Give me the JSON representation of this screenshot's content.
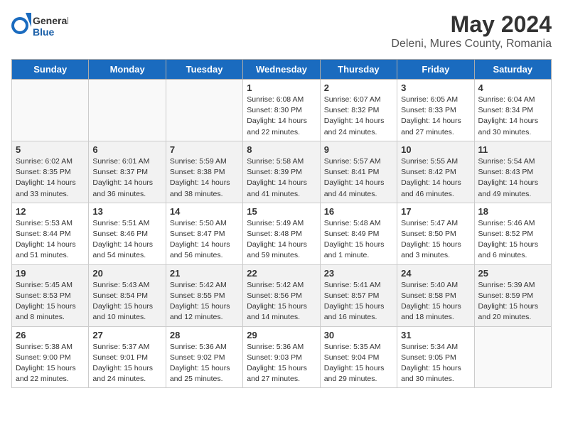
{
  "logo": {
    "text_general": "General",
    "text_blue": "Blue"
  },
  "title": "May 2024",
  "subtitle": "Deleni, Mures County, Romania",
  "days_of_week": [
    "Sunday",
    "Monday",
    "Tuesday",
    "Wednesday",
    "Thursday",
    "Friday",
    "Saturday"
  ],
  "weeks": [
    [
      {
        "day": "",
        "info": ""
      },
      {
        "day": "",
        "info": ""
      },
      {
        "day": "",
        "info": ""
      },
      {
        "day": "1",
        "info": "Sunrise: 6:08 AM\nSunset: 8:30 PM\nDaylight: 14 hours\nand 22 minutes."
      },
      {
        "day": "2",
        "info": "Sunrise: 6:07 AM\nSunset: 8:32 PM\nDaylight: 14 hours\nand 24 minutes."
      },
      {
        "day": "3",
        "info": "Sunrise: 6:05 AM\nSunset: 8:33 PM\nDaylight: 14 hours\nand 27 minutes."
      },
      {
        "day": "4",
        "info": "Sunrise: 6:04 AM\nSunset: 8:34 PM\nDaylight: 14 hours\nand 30 minutes."
      }
    ],
    [
      {
        "day": "5",
        "info": "Sunrise: 6:02 AM\nSunset: 8:35 PM\nDaylight: 14 hours\nand 33 minutes."
      },
      {
        "day": "6",
        "info": "Sunrise: 6:01 AM\nSunset: 8:37 PM\nDaylight: 14 hours\nand 36 minutes."
      },
      {
        "day": "7",
        "info": "Sunrise: 5:59 AM\nSunset: 8:38 PM\nDaylight: 14 hours\nand 38 minutes."
      },
      {
        "day": "8",
        "info": "Sunrise: 5:58 AM\nSunset: 8:39 PM\nDaylight: 14 hours\nand 41 minutes."
      },
      {
        "day": "9",
        "info": "Sunrise: 5:57 AM\nSunset: 8:41 PM\nDaylight: 14 hours\nand 44 minutes."
      },
      {
        "day": "10",
        "info": "Sunrise: 5:55 AM\nSunset: 8:42 PM\nDaylight: 14 hours\nand 46 minutes."
      },
      {
        "day": "11",
        "info": "Sunrise: 5:54 AM\nSunset: 8:43 PM\nDaylight: 14 hours\nand 49 minutes."
      }
    ],
    [
      {
        "day": "12",
        "info": "Sunrise: 5:53 AM\nSunset: 8:44 PM\nDaylight: 14 hours\nand 51 minutes."
      },
      {
        "day": "13",
        "info": "Sunrise: 5:51 AM\nSunset: 8:46 PM\nDaylight: 14 hours\nand 54 minutes."
      },
      {
        "day": "14",
        "info": "Sunrise: 5:50 AM\nSunset: 8:47 PM\nDaylight: 14 hours\nand 56 minutes."
      },
      {
        "day": "15",
        "info": "Sunrise: 5:49 AM\nSunset: 8:48 PM\nDaylight: 14 hours\nand 59 minutes."
      },
      {
        "day": "16",
        "info": "Sunrise: 5:48 AM\nSunset: 8:49 PM\nDaylight: 15 hours\nand 1 minute."
      },
      {
        "day": "17",
        "info": "Sunrise: 5:47 AM\nSunset: 8:50 PM\nDaylight: 15 hours\nand 3 minutes."
      },
      {
        "day": "18",
        "info": "Sunrise: 5:46 AM\nSunset: 8:52 PM\nDaylight: 15 hours\nand 6 minutes."
      }
    ],
    [
      {
        "day": "19",
        "info": "Sunrise: 5:45 AM\nSunset: 8:53 PM\nDaylight: 15 hours\nand 8 minutes."
      },
      {
        "day": "20",
        "info": "Sunrise: 5:43 AM\nSunset: 8:54 PM\nDaylight: 15 hours\nand 10 minutes."
      },
      {
        "day": "21",
        "info": "Sunrise: 5:42 AM\nSunset: 8:55 PM\nDaylight: 15 hours\nand 12 minutes."
      },
      {
        "day": "22",
        "info": "Sunrise: 5:42 AM\nSunset: 8:56 PM\nDaylight: 15 hours\nand 14 minutes."
      },
      {
        "day": "23",
        "info": "Sunrise: 5:41 AM\nSunset: 8:57 PM\nDaylight: 15 hours\nand 16 minutes."
      },
      {
        "day": "24",
        "info": "Sunrise: 5:40 AM\nSunset: 8:58 PM\nDaylight: 15 hours\nand 18 minutes."
      },
      {
        "day": "25",
        "info": "Sunrise: 5:39 AM\nSunset: 8:59 PM\nDaylight: 15 hours\nand 20 minutes."
      }
    ],
    [
      {
        "day": "26",
        "info": "Sunrise: 5:38 AM\nSunset: 9:00 PM\nDaylight: 15 hours\nand 22 minutes."
      },
      {
        "day": "27",
        "info": "Sunrise: 5:37 AM\nSunset: 9:01 PM\nDaylight: 15 hours\nand 24 minutes."
      },
      {
        "day": "28",
        "info": "Sunrise: 5:36 AM\nSunset: 9:02 PM\nDaylight: 15 hours\nand 25 minutes."
      },
      {
        "day": "29",
        "info": "Sunrise: 5:36 AM\nSunset: 9:03 PM\nDaylight: 15 hours\nand 27 minutes."
      },
      {
        "day": "30",
        "info": "Sunrise: 5:35 AM\nSunset: 9:04 PM\nDaylight: 15 hours\nand 29 minutes."
      },
      {
        "day": "31",
        "info": "Sunrise: 5:34 AM\nSunset: 9:05 PM\nDaylight: 15 hours\nand 30 minutes."
      },
      {
        "day": "",
        "info": ""
      }
    ]
  ]
}
